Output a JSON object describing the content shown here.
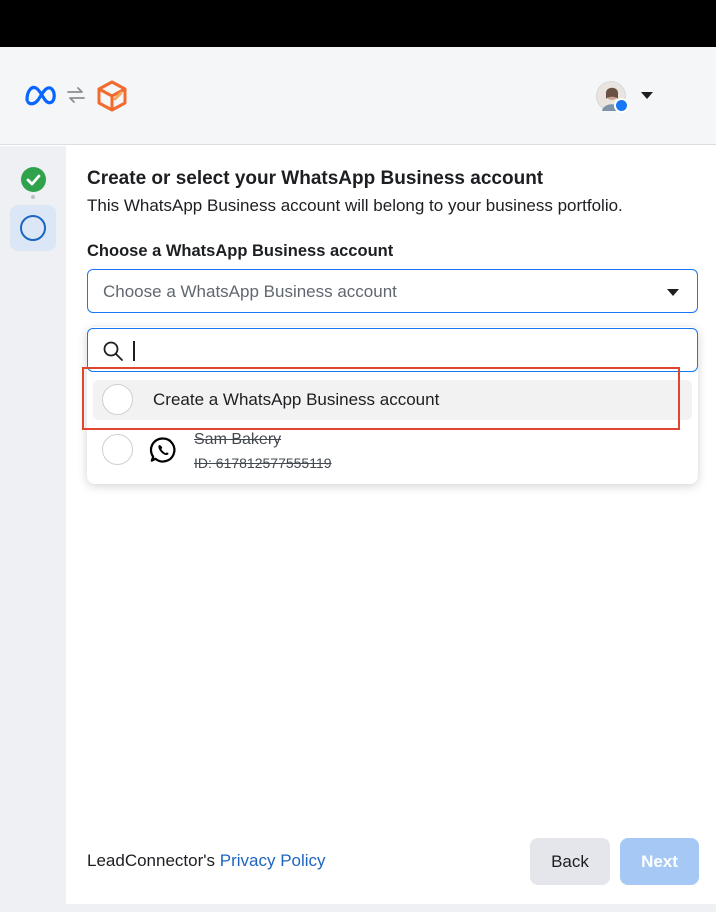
{
  "header": {
    "logos": [
      "meta-logo-icon",
      "swap-icon",
      "app-logo-icon"
    ],
    "avatar_badge": "facebook-icon"
  },
  "steps": [
    {
      "state": "done",
      "icon": "check-icon"
    },
    {
      "state": "current",
      "icon": "circle-icon"
    }
  ],
  "main": {
    "title": "Create or select your WhatsApp Business account",
    "subtitle": "This WhatsApp Business account will belong to your business portfolio.",
    "field_label": "Choose a WhatsApp Business account",
    "select_placeholder": "Choose a WhatsApp Business account",
    "search_value": "",
    "options": [
      {
        "label": "Create a WhatsApp Business account",
        "highlighted": true
      },
      {
        "name": "Sam Bakery",
        "id": "ID: 617812577555119",
        "icon": "whatsapp-icon"
      }
    ]
  },
  "footer": {
    "privacy_prefix": "LeadConnector's",
    "privacy_link": "Privacy Policy",
    "back_label": "Back",
    "next_label": "Next"
  },
  "colors": {
    "accent": "#1877f2",
    "success": "#31a24c",
    "highlight": "#e0452f",
    "next_disabled": "#a6c8f4"
  }
}
